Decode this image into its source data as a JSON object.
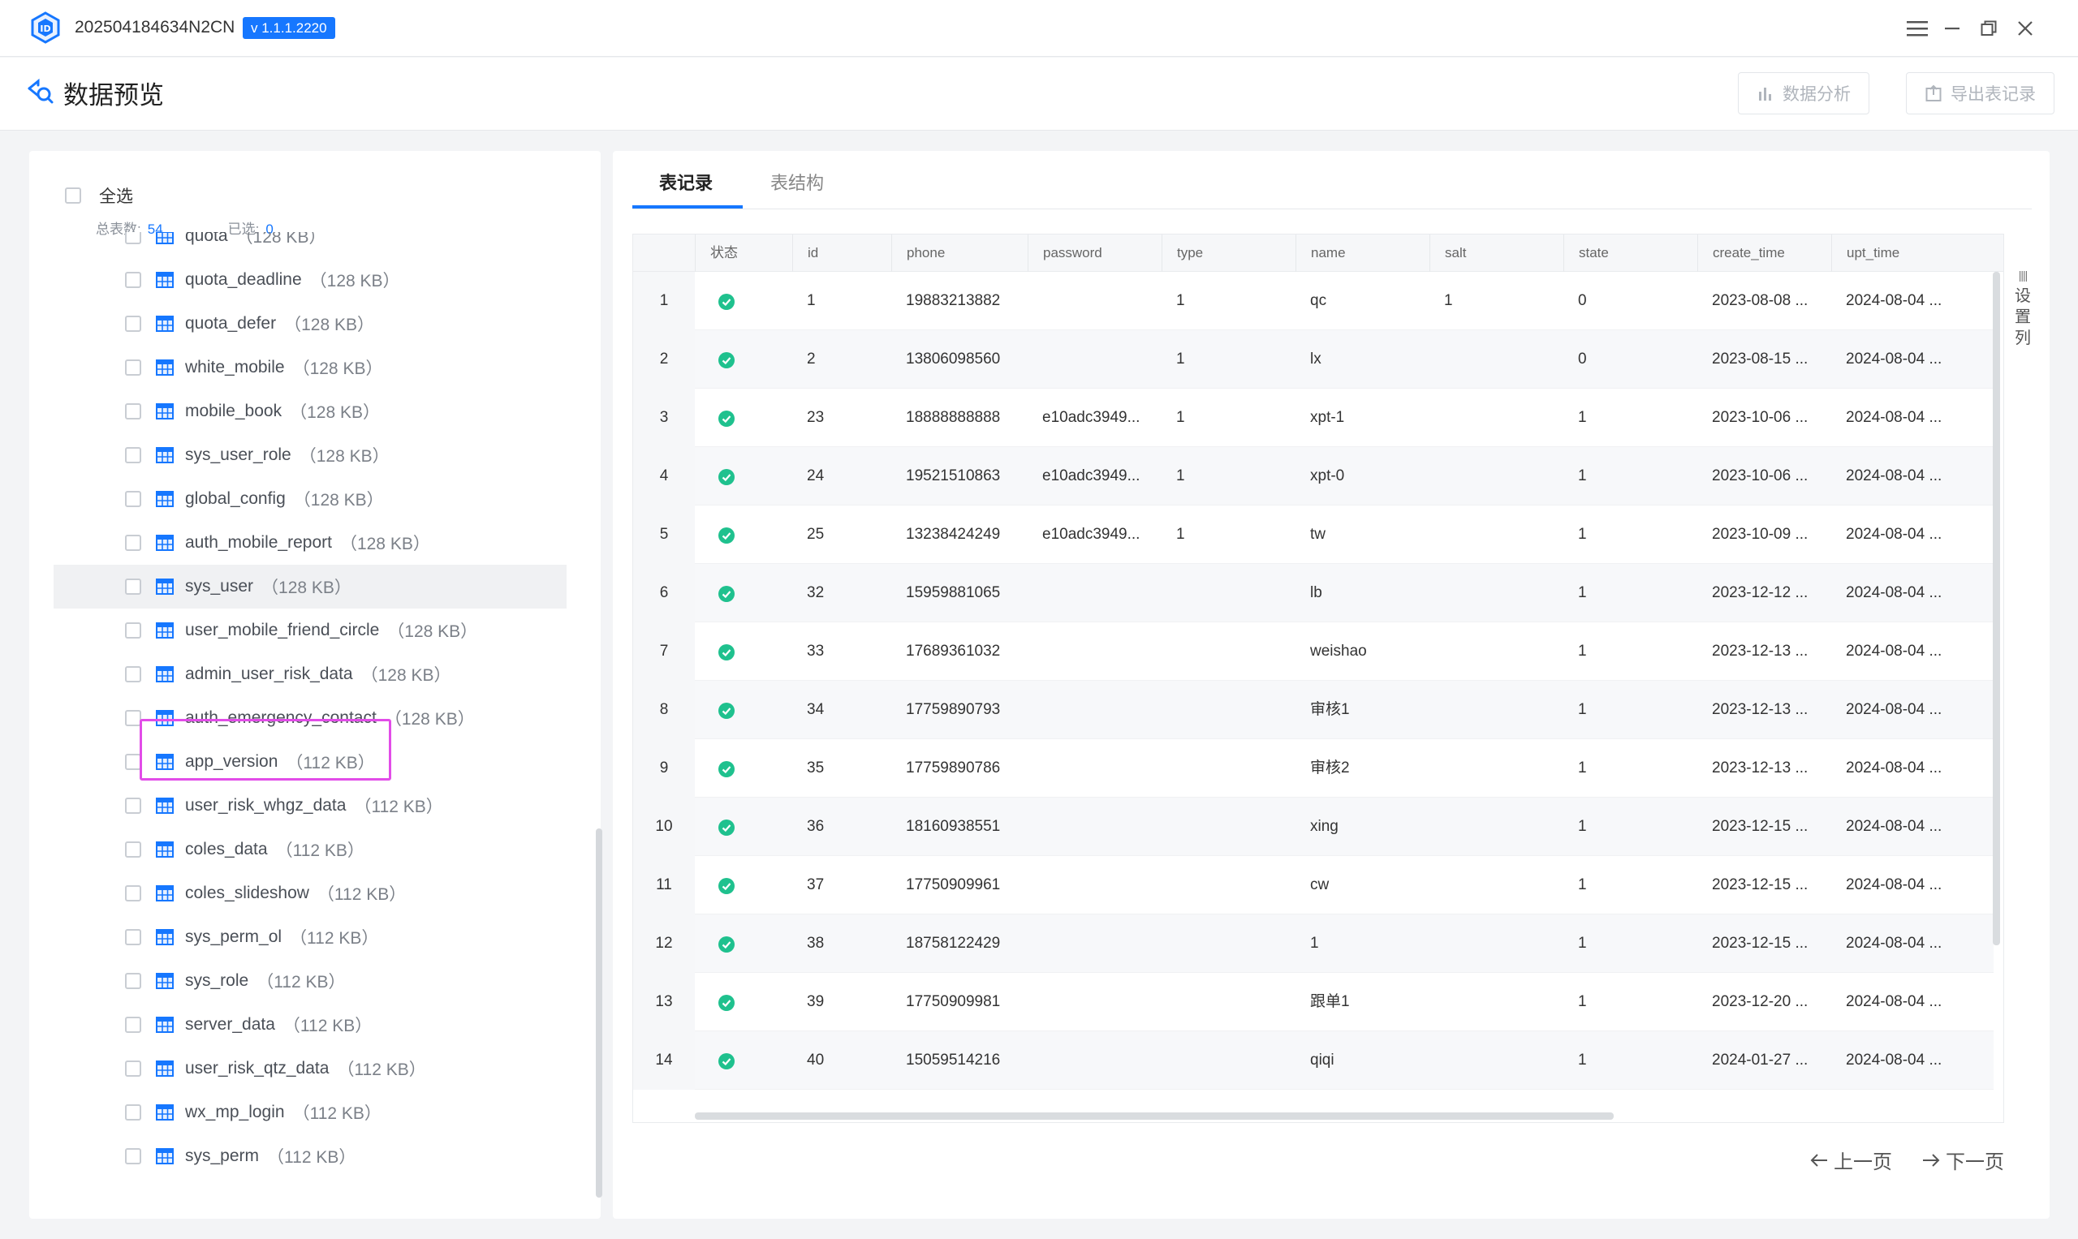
{
  "app": {
    "title": "202504184634N2CN",
    "version": "v 1.1.1.2220"
  },
  "page": {
    "title": "数据预览"
  },
  "header_buttons": {
    "analyze": "数据分析",
    "export": "导出表记录"
  },
  "sidebar": {
    "select_all": "全选",
    "total_label": "总表数:",
    "total_value": "54",
    "selected_label": "已选:",
    "selected_value": "0",
    "items": [
      {
        "name": "quota",
        "size": "（128 KB）"
      },
      {
        "name": "quota_deadline",
        "size": "（128 KB）"
      },
      {
        "name": "quota_defer",
        "size": "（128 KB）"
      },
      {
        "name": "white_mobile",
        "size": "（128 KB）"
      },
      {
        "name": "mobile_book",
        "size": "（128 KB）"
      },
      {
        "name": "sys_user_role",
        "size": "（128 KB）"
      },
      {
        "name": "global_config",
        "size": "（128 KB）"
      },
      {
        "name": "auth_mobile_report",
        "size": "（128 KB）"
      },
      {
        "name": "sys_user",
        "size": "（128 KB）"
      },
      {
        "name": "user_mobile_friend_circle",
        "size": "（128 KB）"
      },
      {
        "name": "admin_user_risk_data",
        "size": "（128 KB）"
      },
      {
        "name": "auth_emergency_contact",
        "size": "（128 KB）"
      },
      {
        "name": "app_version",
        "size": "（112 KB）"
      },
      {
        "name": "user_risk_whgz_data",
        "size": "（112 KB）"
      },
      {
        "name": "coles_data",
        "size": "（112 KB）"
      },
      {
        "name": "coles_slideshow",
        "size": "（112 KB）"
      },
      {
        "name": "sys_perm_ol",
        "size": "（112 KB）"
      },
      {
        "name": "sys_role",
        "size": "（112 KB）"
      },
      {
        "name": "server_data",
        "size": "（112 KB）"
      },
      {
        "name": "user_risk_qtz_data",
        "size": "（112 KB）"
      },
      {
        "name": "wx_mp_login",
        "size": "（112 KB）"
      },
      {
        "name": "sys_perm",
        "size": "（112 KB）"
      }
    ]
  },
  "tabs": {
    "records": "表记录",
    "structure": "表结构"
  },
  "table": {
    "columns": [
      "状态",
      "id",
      "phone",
      "password",
      "type",
      "name",
      "salt",
      "state",
      "create_time",
      "upt_time"
    ],
    "rows": [
      {
        "n": "1",
        "id": "1",
        "phone": "19883213882",
        "password": "",
        "type": "1",
        "name": "qc",
        "salt": "1",
        "state": "0",
        "create_time": "2023-08-08 ...",
        "upt_time": "2024-08-04 ..."
      },
      {
        "n": "2",
        "id": "2",
        "phone": "13806098560",
        "password": "",
        "type": "1",
        "name": "lx",
        "salt": "",
        "state": "0",
        "create_time": "2023-08-15 ...",
        "upt_time": "2024-08-04 ..."
      },
      {
        "n": "3",
        "id": "23",
        "phone": "18888888888",
        "password": "e10adc3949...",
        "type": "1",
        "name": "xpt-1",
        "salt": "",
        "state": "1",
        "create_time": "2023-10-06 ...",
        "upt_time": "2024-08-04 ..."
      },
      {
        "n": "4",
        "id": "24",
        "phone": "19521510863",
        "password": "e10adc3949...",
        "type": "1",
        "name": "xpt-0",
        "salt": "",
        "state": "1",
        "create_time": "2023-10-06 ...",
        "upt_time": "2024-08-04 ..."
      },
      {
        "n": "5",
        "id": "25",
        "phone": "13238424249",
        "password": "e10adc3949...",
        "type": "1",
        "name": "tw",
        "salt": "",
        "state": "1",
        "create_time": "2023-10-09 ...",
        "upt_time": "2024-08-04 ..."
      },
      {
        "n": "6",
        "id": "32",
        "phone": "15959881065",
        "password": "",
        "type": "",
        "name": "lb",
        "salt": "",
        "state": "1",
        "create_time": "2023-12-12 ...",
        "upt_time": "2024-08-04 ..."
      },
      {
        "n": "7",
        "id": "33",
        "phone": "17689361032",
        "password": "",
        "type": "",
        "name": "weishao",
        "salt": "",
        "state": "1",
        "create_time": "2023-12-13 ...",
        "upt_time": "2024-08-04 ..."
      },
      {
        "n": "8",
        "id": "34",
        "phone": "17759890793",
        "password": "",
        "type": "",
        "name": "审核1",
        "salt": "",
        "state": "1",
        "create_time": "2023-12-13 ...",
        "upt_time": "2024-08-04 ..."
      },
      {
        "n": "9",
        "id": "35",
        "phone": "17759890786",
        "password": "",
        "type": "",
        "name": "审核2",
        "salt": "",
        "state": "1",
        "create_time": "2023-12-13 ...",
        "upt_time": "2024-08-04 ..."
      },
      {
        "n": "10",
        "id": "36",
        "phone": "18160938551",
        "password": "",
        "type": "",
        "name": "xing",
        "salt": "",
        "state": "1",
        "create_time": "2023-12-15 ...",
        "upt_time": "2024-08-04 ..."
      },
      {
        "n": "11",
        "id": "37",
        "phone": "17750909961",
        "password": "",
        "type": "",
        "name": "cw",
        "salt": "",
        "state": "1",
        "create_time": "2023-12-15 ...",
        "upt_time": "2024-08-04 ..."
      },
      {
        "n": "12",
        "id": "38",
        "phone": "18758122429",
        "password": "",
        "type": "",
        "name": "1",
        "salt": "",
        "state": "1",
        "create_time": "2023-12-15 ...",
        "upt_time": "2024-08-04 ..."
      },
      {
        "n": "13",
        "id": "39",
        "phone": "17750909981",
        "password": "",
        "type": "",
        "name": "跟单1",
        "salt": "",
        "state": "1",
        "create_time": "2023-12-20 ...",
        "upt_time": "2024-08-04 ..."
      },
      {
        "n": "14",
        "id": "40",
        "phone": "15059514216",
        "password": "",
        "type": "",
        "name": "qiqi",
        "salt": "",
        "state": "1",
        "create_time": "2024-01-27 ...",
        "upt_time": "2024-08-04 ..."
      }
    ]
  },
  "set_columns": {
    "label_1": "设",
    "label_2": "置",
    "label_3": "列"
  },
  "pager": {
    "prev": "上一页",
    "next": "下一页"
  },
  "colors": {
    "accent": "#1677ff",
    "ok": "#1fc18e",
    "highlight": "#e24ce8"
  }
}
